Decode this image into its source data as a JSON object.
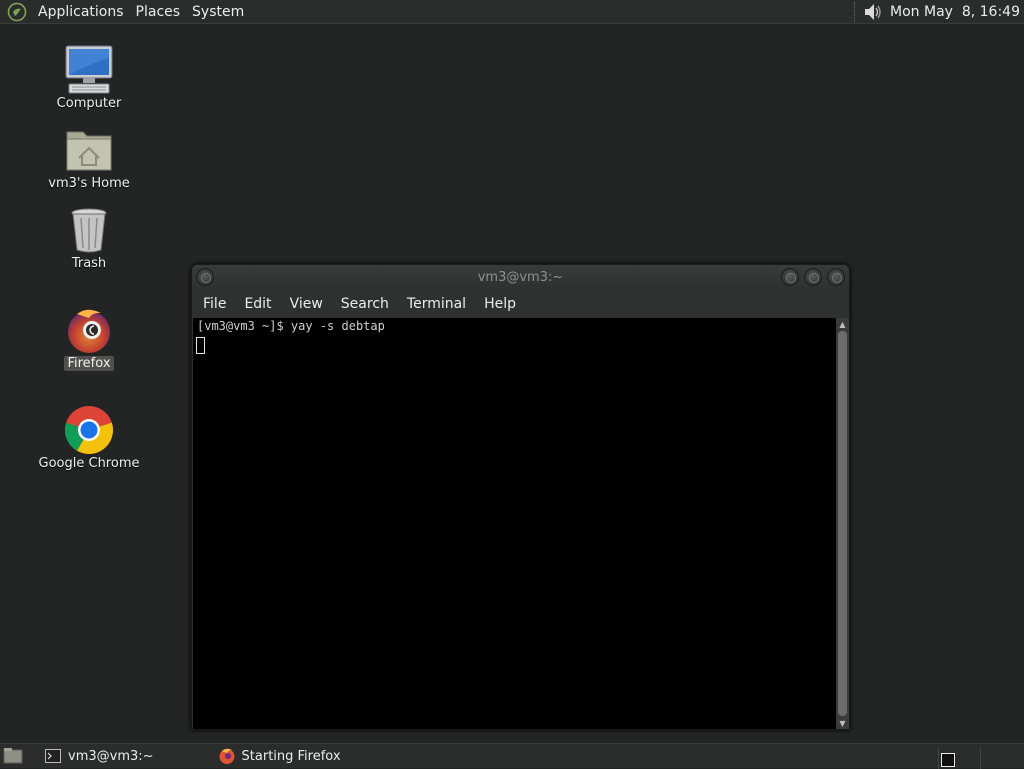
{
  "top_panel": {
    "menus": [
      "Applications",
      "Places",
      "System"
    ],
    "clock": "Mon May  8, 16:49",
    "icons": {
      "logo": "mate-logo-icon",
      "volume": "volume-icon"
    }
  },
  "desktop": {
    "icons": [
      {
        "label": "Computer",
        "icon": "computer-icon"
      },
      {
        "label": "vm3's Home",
        "icon": "home-folder-icon"
      },
      {
        "label": "Trash",
        "icon": "trash-icon"
      },
      {
        "label": "Firefox",
        "icon": "firefox-icon",
        "selected": true
      },
      {
        "label": "Google Chrome",
        "icon": "chrome-icon"
      }
    ]
  },
  "terminal": {
    "title": "vm3@vm3:~",
    "menus": [
      "File",
      "Edit",
      "View",
      "Search",
      "Terminal",
      "Help"
    ],
    "lines": [
      "[vm3@vm3 ~]$ yay -s debtap"
    ]
  },
  "bottom_panel": {
    "tasks": [
      {
        "label": "vm3@vm3:~",
        "icon": "terminal-icon"
      },
      {
        "label": "Starting Firefox",
        "icon": "firefox-icon"
      }
    ]
  },
  "colors": {
    "desktop_bg": "#232424",
    "panel_bg": "#2b2c2c",
    "terminal_bg": "#000000"
  }
}
